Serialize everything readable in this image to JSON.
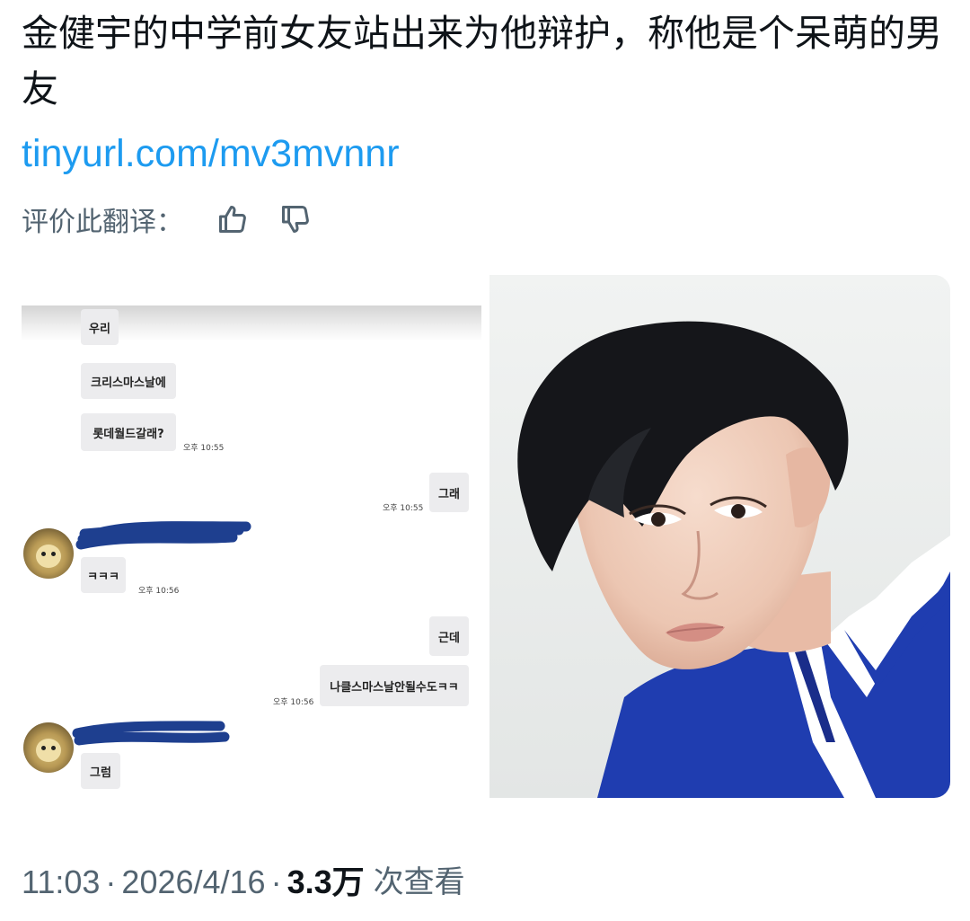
{
  "tweet": {
    "text": "金健宇的中学前女友站出来为他辩护，称他是个呆萌的男友",
    "link": "tinyurl.com/mv3mvnnr"
  },
  "rating": {
    "label": "评价此翻译：",
    "icons": [
      "thumbs-up-icon",
      "thumbs-down-icon"
    ]
  },
  "chat": {
    "bubbles": [
      {
        "text": "우리"
      },
      {
        "text": "크리스마스날에"
      },
      {
        "text": "롯데월드갈래?"
      },
      {
        "text": "그래"
      },
      {
        "text": "ㅋㅋㅋ"
      },
      {
        "text": "근데"
      },
      {
        "text": "나클스마스날안될수도ㅋㅋ"
      },
      {
        "text": "그럼"
      }
    ],
    "times": [
      "오후 10:55",
      "오후 10:55",
      "오후 10:56",
      "오후 10:56"
    ]
  },
  "meta": {
    "time": "11:03",
    "dot": "·",
    "date": "2026/4/16",
    "views": "3.3万",
    "views_label": "次查看"
  },
  "colors": {
    "link": "#1d9bf0",
    "secondary_text": "#536471",
    "redaction": "#1e3f8f"
  }
}
